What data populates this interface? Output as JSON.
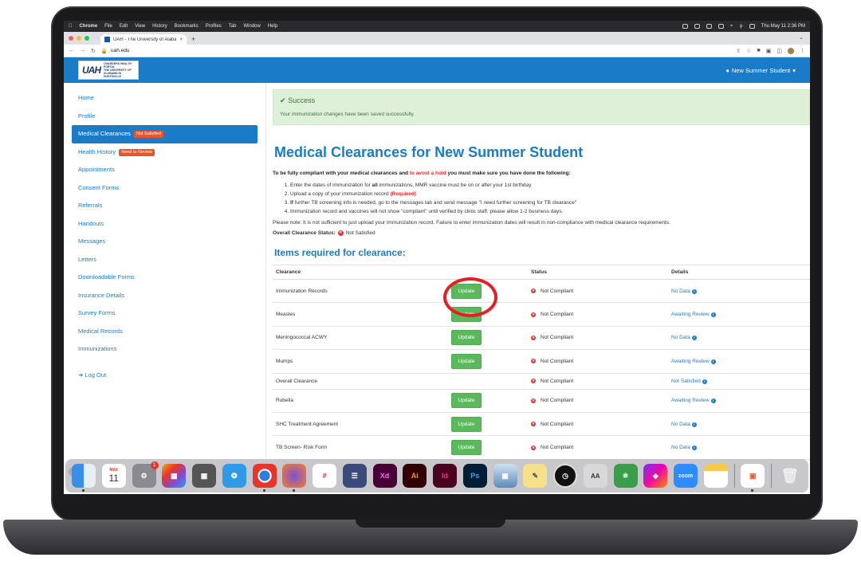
{
  "menubar": {
    "apple": "",
    "app": "Chrome",
    "items": [
      "File",
      "Edit",
      "View",
      "History",
      "Bookmarks",
      "Profiles",
      "Tab",
      "Window",
      "Help"
    ],
    "clock": "Thu May 11  2:36 PM"
  },
  "browser": {
    "tab_title": "UAH - The University of Alabam",
    "url": "uah.edu"
  },
  "header": {
    "logo_mark": "UAH",
    "logo_text": "CHARGERS HEALTH PORTAL",
    "logo_subtext": "THE UNIVERSITY OF ALABAMA IN HUNTSVILLE",
    "user_label": "New Summer Student"
  },
  "sidebar": {
    "items": [
      {
        "label": "Home"
      },
      {
        "label": "Profile"
      },
      {
        "label": "Medical Clearances",
        "badge": "Not Satisfied"
      },
      {
        "label": "Health History",
        "badge": "Need to Review"
      },
      {
        "label": "Appointments"
      },
      {
        "label": "Consent Forms"
      },
      {
        "label": "Referrals"
      },
      {
        "label": "Handouts"
      },
      {
        "label": "Messages"
      },
      {
        "label": "Letters"
      },
      {
        "label": "Downloadable Forms"
      },
      {
        "label": "Insurance Details"
      },
      {
        "label": "Survey Forms"
      },
      {
        "label": "Medical Records"
      },
      {
        "label": "Immunizations"
      }
    ],
    "logout": "Log Out"
  },
  "alert": {
    "title": "Success",
    "message": "Your immunization changes have been saved successfully."
  },
  "main": {
    "title": "Medical Clearances for New Summer Student",
    "intro_bold": "To be fully compliant with your medical clearances and",
    "intro_red": "to avoid a hold",
    "intro_rest": "you must make sure you have done the following:",
    "step1_a": "Enter the dates of immunization for",
    "step1_b": "all",
    "step1_c": "immunizations, MMR vaccine must be on or after your 1st birthday.",
    "step2_a": "Upload a copy of your immunization record",
    "step2_b": "(Required)",
    "step3_a": "If",
    "step3_b": "further TB screening info is needed, go to the messages tab and send message \"I need further screening for TB clearance\"",
    "step4": "Immunization record and vaccines will not show \"compliant\" until verified by clinic staff, please allow 1-2 business days.",
    "note": "Please note: It is not sufficient to just upload your immunization record. Failure to enter immunization dates will result in non-compliance with medical clearance requirements.",
    "overall_label": "Overall Clearance Status:",
    "overall_value": "Not Satisfied",
    "section_title": "Items required for clearance:"
  },
  "table": {
    "headers": {
      "clearance": "Clearance",
      "status": "Status",
      "details": "Details"
    },
    "update_label": "Update",
    "rows": [
      {
        "clearance": "Immunization Records",
        "status": "Not Compliant",
        "details": "No Data"
      },
      {
        "clearance": "Measles",
        "status": "Not Compliant",
        "details": "Awaiting Review"
      },
      {
        "clearance": "Meningococcal ACWY",
        "status": "Not Compliant",
        "details": "No Data"
      },
      {
        "clearance": "Mumps",
        "status": "Not Compliant",
        "details": "Awaiting Review"
      },
      {
        "clearance": "Overall Clearance",
        "status": "Not Compliant",
        "details": "Not Satisfied"
      },
      {
        "clearance": "Rubella",
        "status": "Not Compliant",
        "details": "Awaiting Review"
      },
      {
        "clearance": "SHC Treatment Agreement",
        "status": "Not Compliant",
        "details": "No Data"
      },
      {
        "clearance": "TB Screen- Risk Form",
        "status": "Not Compliant",
        "details": "No Data"
      }
    ]
  },
  "dock": {
    "calendar_month": "MAY",
    "calendar_day": "11",
    "settings_badge": "1",
    "xd": "Xd",
    "ai": "Ai",
    "id": "Id",
    "ps": "Ps",
    "zoom": "zoom"
  }
}
